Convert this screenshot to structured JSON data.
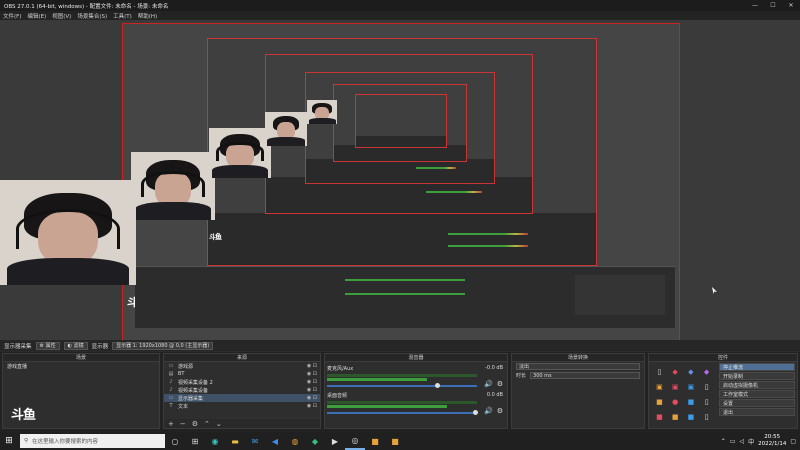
{
  "window": {
    "title": "OBS 27.0.1 (64-bit, windows) - 配置文件: 未命名 - 场景: 未命名",
    "minimize": "—",
    "maximize": "☐",
    "close": "✕"
  },
  "menu": [
    "文件(F)",
    "编辑(E)",
    "视图(V)",
    "场景集合(S)",
    "工具(T)",
    "帮助(H)"
  ],
  "preview": {
    "logo_text": "斗鱼",
    "canvas_border_color": "#cc2222"
  },
  "scene_bar": {
    "label": "显示器采集",
    "properties": "属性",
    "filters": "滤镜",
    "display_label": "显示器",
    "display_value": "显示器 1: 1920x1080 @ 0,0 (主显示器)"
  },
  "docks": {
    "scenes": {
      "title": "场景",
      "items": [
        "游戏直播"
      ]
    },
    "sources": {
      "title": "来源",
      "items": [
        {
          "icon": "game-icon",
          "glyph": "▭",
          "label": "游戏源"
        },
        {
          "icon": "text-icon",
          "glyph": "▤",
          "label": "BT"
        },
        {
          "icon": "audio-icon",
          "glyph": "♪",
          "label": "视频采集设备 2"
        },
        {
          "icon": "audio-icon",
          "glyph": "♪",
          "label": "视频采集设备"
        },
        {
          "icon": "monitor-icon",
          "glyph": "▭",
          "label": "显示器采集"
        },
        {
          "icon": "text-icon",
          "glyph": "T",
          "label": "文本"
        }
      ]
    },
    "mixer": {
      "title": "混音器",
      "channels": [
        {
          "name": "麦克风/Aux",
          "db": "-0.0 dB"
        },
        {
          "name": "桌面音频",
          "db": "0.0 dB"
        }
      ]
    },
    "transitions": {
      "title": "场景转换",
      "type_value": "淡出",
      "duration_label": "时长",
      "duration_value": "300 ms"
    },
    "controls": {
      "title": "控件",
      "buttons": [
        "停止推流",
        "开始录制",
        "启动虚拟摄像机",
        "工作室模式",
        "设置",
        "退出"
      ]
    }
  },
  "taskbar": {
    "search_placeholder": "在这里输入你要搜索的内容",
    "tray_lang": "中",
    "time": "20:55",
    "date": "2022/1/14"
  }
}
